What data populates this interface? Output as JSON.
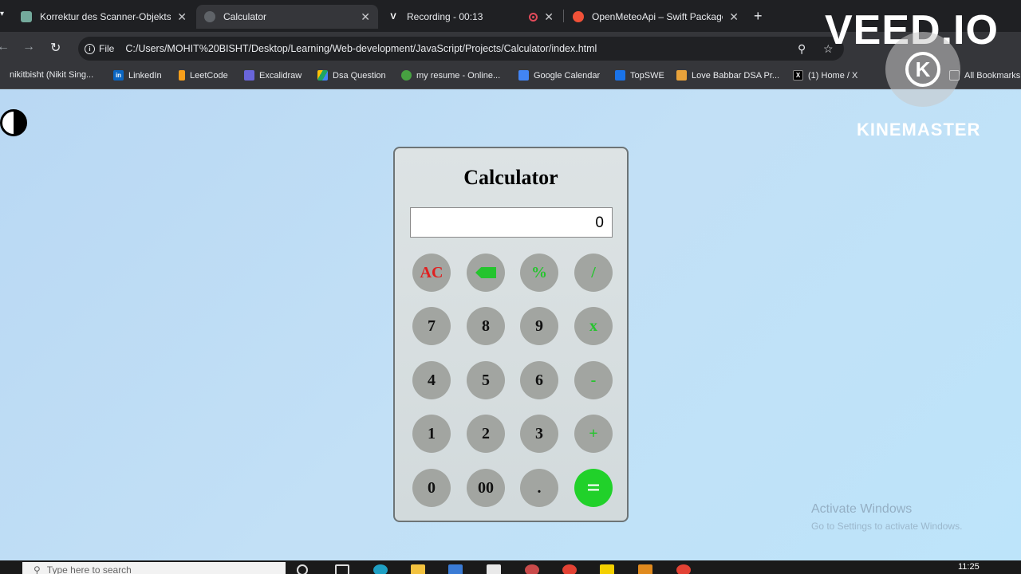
{
  "browser": {
    "tabs": [
      {
        "title": "Korrektur des Scanner-Objekts",
        "icon": "chatgpt-icon",
        "active": false
      },
      {
        "title": "Calculator",
        "icon": "globe-icon",
        "active": true
      },
      {
        "title": "Recording - 00:13",
        "icon": "veed-icon",
        "active": false,
        "recording": true
      },
      {
        "title": "OpenMeteoApi – Swift Package",
        "icon": "swift-icon",
        "active": false
      }
    ],
    "close_glyph": "✕",
    "new_tab_glyph": "+",
    "site_info_label": "File",
    "url": "C:/Users/MOHIT%20BISHT/Desktop/Learning/Web-development/JavaScript/Projects/Calculator/index.html",
    "bookmarks": [
      {
        "label": "nikitbisht (Nikit Sing...",
        "icon": "github-icon",
        "color": "#24292e"
      },
      {
        "label": "LinkedIn",
        "icon": "linkedin-icon",
        "color": "#0a66c2",
        "glyph": "in"
      },
      {
        "label": "LeetCode",
        "icon": "leetcode-icon",
        "color": "#f89f1b"
      },
      {
        "label": "Excalidraw",
        "icon": "excalidraw-icon",
        "color": "#6965db"
      },
      {
        "label": "Dsa Question",
        "icon": "drive-icon",
        "color": "#1fa463"
      },
      {
        "label": "my resume - Online...",
        "icon": "overleaf-icon",
        "color": "#47a141"
      },
      {
        "label": "Google Calendar",
        "icon": "calendar-icon",
        "color": "#4285f4"
      },
      {
        "label": "TopSWE",
        "icon": "topswe-icon",
        "color": "#1a73e8"
      },
      {
        "label": "Love Babbar DSA Pr...",
        "icon": "codehelp-icon",
        "color": "#e8a23a"
      },
      {
        "label": "(1) Home / X",
        "icon": "x-icon",
        "color": "#000000",
        "glyph": "X"
      }
    ],
    "all_bookmarks_label": "All Bookmarks"
  },
  "calculator": {
    "title": "Calculator",
    "display_value": "0",
    "keys": [
      [
        "AC",
        "⌫",
        "%",
        "/"
      ],
      [
        "7",
        "8",
        "9",
        "x"
      ],
      [
        "4",
        "5",
        "6",
        "-"
      ],
      [
        "1",
        "2",
        "3",
        "+"
      ],
      [
        "0",
        "00",
        ".",
        "="
      ]
    ]
  },
  "overlays": {
    "veed_watermark": "VEED.IO",
    "kinemaster_letter": "K",
    "kinemaster_text": "KINEMASTER",
    "activate_title": "Activate Windows",
    "activate_subtitle": "Go to Settings to activate Windows."
  },
  "taskbar": {
    "search_placeholder": "Type here to search",
    "clock": "11:25"
  },
  "colors": {
    "operator_text": "#25c42e",
    "clear_text": "#e02020",
    "equals_bg": "#21d12a",
    "key_bg": "#a2a5a1"
  }
}
